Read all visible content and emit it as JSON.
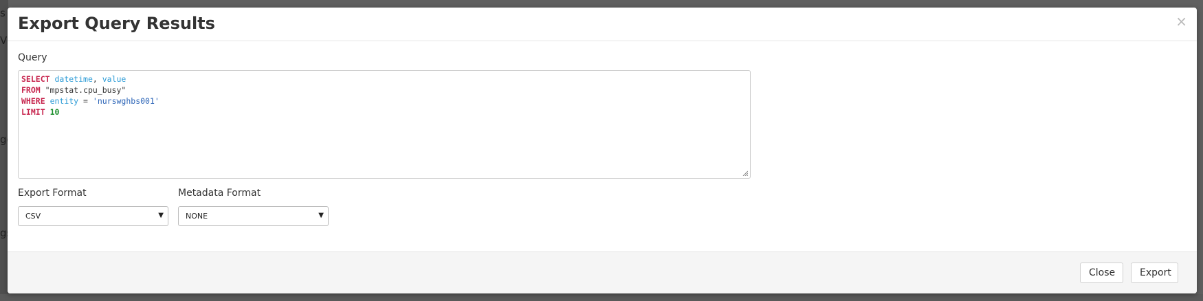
{
  "background_fragments": [
    "s",
    "V",
    "ge",
    "gs"
  ],
  "modal": {
    "title": "Export Query Results",
    "close_glyph": "×",
    "query_label": "Query",
    "query_lines": [
      [
        {
          "t": "SELECT",
          "c": "kw"
        },
        {
          "t": " ",
          "c": ""
        },
        {
          "t": "datetime",
          "c": "col"
        },
        {
          "t": ", ",
          "c": ""
        },
        {
          "t": "value",
          "c": "col"
        }
      ],
      [
        {
          "t": "FROM",
          "c": "kw"
        },
        {
          "t": " \"mpstat.cpu_busy\"",
          "c": ""
        }
      ],
      [
        {
          "t": "WHERE",
          "c": "kw"
        },
        {
          "t": " ",
          "c": ""
        },
        {
          "t": "entity",
          "c": "col"
        },
        {
          "t": " = ",
          "c": ""
        },
        {
          "t": "'nurswghbs001'",
          "c": "str"
        }
      ],
      [
        {
          "t": "LIMIT",
          "c": "kw"
        },
        {
          "t": " ",
          "c": ""
        },
        {
          "t": "10",
          "c": "num"
        }
      ]
    ],
    "export_format": {
      "label": "Export Format",
      "value": "CSV"
    },
    "metadata_format": {
      "label": "Metadata Format",
      "value": "NONE"
    },
    "dropdown_glyph": "▼",
    "buttons": {
      "close": "Close",
      "export": "Export"
    }
  },
  "colors": {
    "keyword": "#c7254e",
    "column": "#2b9bd6",
    "string": "#2b64b7",
    "number": "#1d8f2e"
  }
}
